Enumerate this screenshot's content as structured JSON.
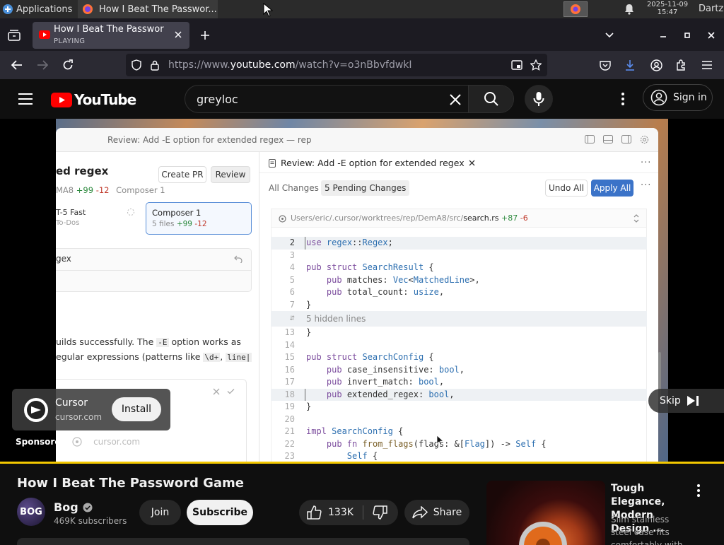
{
  "taskbar": {
    "apps_label": "Applications",
    "task_title": "How I Beat The Passwor...",
    "clock_date": "2025-11-09",
    "clock_time": "15:47",
    "user": "Dartz"
  },
  "browser": {
    "tab_title": "How I Beat The Passwor",
    "tab_status": "PLAYING",
    "url_prefix": "https://www.",
    "url_domain": "youtube.com",
    "url_path": "/watch?v=o3nBbvfdwkI"
  },
  "youtube": {
    "logo_text": "YouTube",
    "search_query": "greyloc",
    "sign_in": "Sign in"
  },
  "video": {
    "window_title": "Review: Add -E option for extended regex — rep",
    "left": {
      "heading": "ed regex",
      "create_pr": "Create PR",
      "review": "Review",
      "meta_prefix": "MA8",
      "meta_adds": "+99",
      "meta_dels": "-12",
      "meta_suffix": "Composer 1",
      "card1_title": "T-5 Fast",
      "card1_sub": "To-Dos",
      "card2_title": "Composer 1",
      "card2_files": "5 files",
      "card2_adds": "+99",
      "card2_dels": "-12",
      "item": "gex",
      "body1_a": "uilds successfully. The ",
      "body1_code": "-E",
      "body1_b": " option works as",
      "body2_a": "egular expressions (patterns like ",
      "body2_code1": "\\d+",
      "body2_sep": ", ",
      "body2_code2": "line|"
    },
    "right": {
      "tab_title": "Review: Add -E option for extended regex",
      "all_changes": "All Changes",
      "pending": "5 Pending Changes",
      "undo_all": "Undo All",
      "apply_all": "Apply All",
      "file_path": "Users/eric/.cursor/worktrees/rep/DemA8/src/",
      "file_name": "search.rs",
      "file_adds": "+87",
      "file_dels": "-6",
      "hidden_lines": "5 hidden lines"
    },
    "ad": {
      "name": "Cursor",
      "domain": "cursor.com",
      "install": "Install",
      "sponsored": "Sponsored",
      "sponsored_domain": "cursor.com"
    },
    "skip": "Skip"
  },
  "meta": {
    "title": "How I Beat The Password Game",
    "channel": "Bog",
    "avatar_text": "BOG",
    "subscribers": "469K subscribers",
    "join": "Join",
    "subscribe": "Subscribe",
    "likes": "133K",
    "share": "Share"
  },
  "recommendation": {
    "title": "Tough Elegance, Modern Design ...",
    "desc": "Slim stainless steel case fits comfortably with"
  },
  "colors": {
    "yt_red": "#ff0000",
    "highlight_yellow": "#f3c800",
    "diff_add": "#2d8a3e",
    "diff_del": "#c0392b",
    "apply_blue": "#3b73c8"
  }
}
